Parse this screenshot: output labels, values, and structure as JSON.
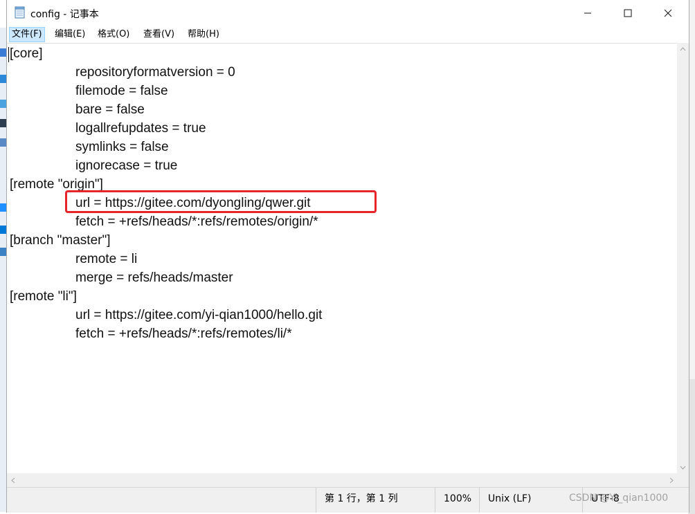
{
  "window": {
    "title": "config - 记事本",
    "controls": {
      "minimize": "—",
      "maximize": "☐",
      "close": "✕"
    }
  },
  "menu": [
    {
      "label": "文件(F)",
      "active": true
    },
    {
      "label": "编辑(E)"
    },
    {
      "label": "格式(O)"
    },
    {
      "label": "查看(V)"
    },
    {
      "label": "帮助(H)"
    }
  ],
  "content": {
    "lines": [
      {
        "text": "[core]",
        "indent": false
      },
      {
        "text": "repositoryformatversion = 0",
        "indent": true
      },
      {
        "text": "filemode = false",
        "indent": true
      },
      {
        "text": "bare = false",
        "indent": true
      },
      {
        "text": "logallrefupdates = true",
        "indent": true
      },
      {
        "text": "symlinks = false",
        "indent": true
      },
      {
        "text": "ignorecase = true",
        "indent": true
      },
      {
        "text": "[remote \"origin\"]",
        "indent": false
      },
      {
        "text": "url = https://gitee.com/dyongling/qwer.git",
        "indent": true,
        "highlighted": true
      },
      {
        "text": "fetch = +refs/heads/*:refs/remotes/origin/*",
        "indent": true
      },
      {
        "text": "[branch \"master\"]",
        "indent": false
      },
      {
        "text": "remote = li",
        "indent": true
      },
      {
        "text": "merge = refs/heads/master",
        "indent": true
      },
      {
        "text": "[remote \"li\"]",
        "indent": false
      },
      {
        "text": "url = https://gitee.com/yi-qian1000/hello.git",
        "indent": true
      },
      {
        "text": "fetch = +refs/heads/*:refs/remotes/li/*",
        "indent": true
      }
    ],
    "highlight_color": "#e8242b"
  },
  "status": {
    "position": "第 1 行，第 1 列",
    "zoom": "100%",
    "line_ending": "Unix (LF)",
    "encoding": "UTF-8"
  },
  "watermark": "CSDN @Yi_qian1000",
  "icons": {
    "app": "notepad-icon",
    "minimize": "minimize-icon",
    "maximize": "maximize-icon",
    "close": "close-icon"
  }
}
